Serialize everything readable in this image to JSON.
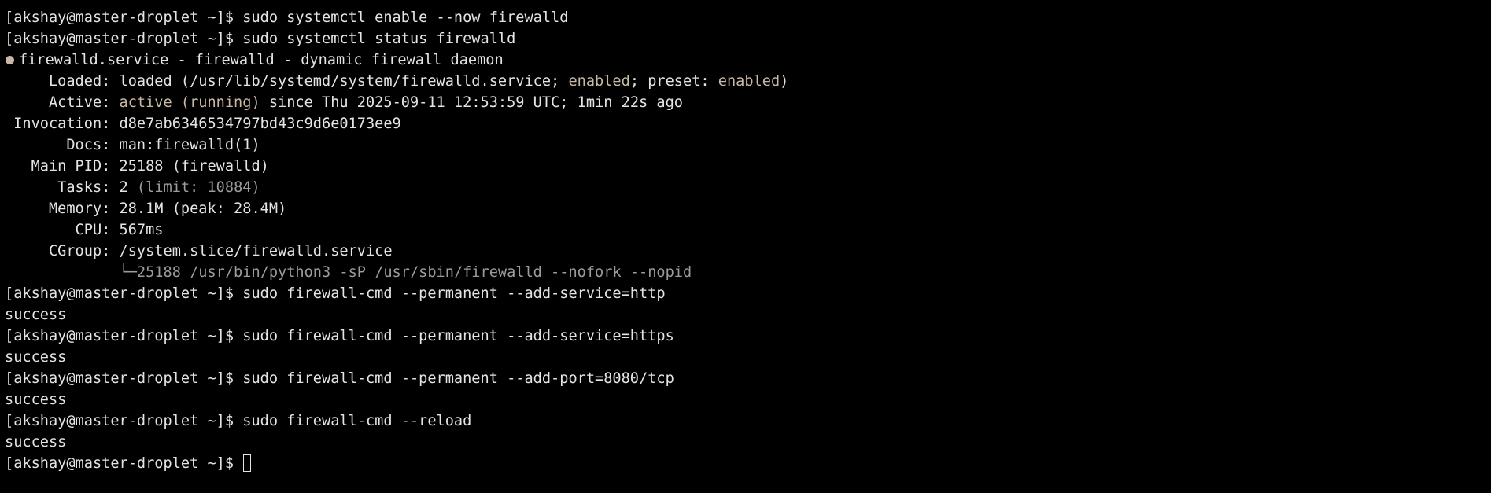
{
  "terminal": {
    "prompt": "[akshay@master-droplet ~]$ ",
    "commands": {
      "enable": "sudo systemctl enable --now firewalld",
      "status": "sudo systemctl status firewalld",
      "add_http": "sudo firewall-cmd --permanent --add-service=http",
      "add_https": "sudo firewall-cmd --permanent --add-service=https",
      "add_port": "sudo firewall-cmd --permanent --add-port=8080/tcp",
      "reload": "sudo firewall-cmd --reload"
    },
    "outputs": {
      "http": "success",
      "https": "success",
      "port": "success",
      "reload": "success"
    },
    "status": {
      "colors": {
        "accent": "#c8b8a6",
        "dim": "#9c9c9c"
      },
      "unit_line": "firewalld.service - firewalld - dynamic firewall daemon",
      "loaded": {
        "label": "     Loaded: ",
        "text_a": "loaded (/usr/lib/systemd/system/firewalld.service; ",
        "enabled": "enabled",
        "text_b": "; preset: ",
        "preset": "enabled",
        "text_c": ")"
      },
      "active": {
        "label": "     Active: ",
        "state": "active (running)",
        "since": " since Thu 2025-09-11 12:53:59 UTC; 1min 22s ago"
      },
      "invocation": {
        "label": " Invocation: ",
        "value": "d8e7ab6346534797bd43c9d6e0173ee9"
      },
      "docs": {
        "label": "       Docs: ",
        "value": "man:firewalld(1)"
      },
      "main_pid": {
        "label": "   Main PID: ",
        "value": "25188 (firewalld)"
      },
      "tasks": {
        "label": "      Tasks: ",
        "value": "2",
        "limit": " (limit: 10884)"
      },
      "memory": {
        "label": "     Memory: ",
        "value": "28.1M (peak: 28.4M)"
      },
      "cpu": {
        "label": "        CPU: ",
        "value": "567ms"
      },
      "cgroup": {
        "label": "     CGroup: ",
        "value": "/system.slice/firewalld.service"
      },
      "cgroup_tree": "             └─25188 /usr/bin/python3 -sP /usr/sbin/firewalld --nofork --nopid"
    }
  }
}
